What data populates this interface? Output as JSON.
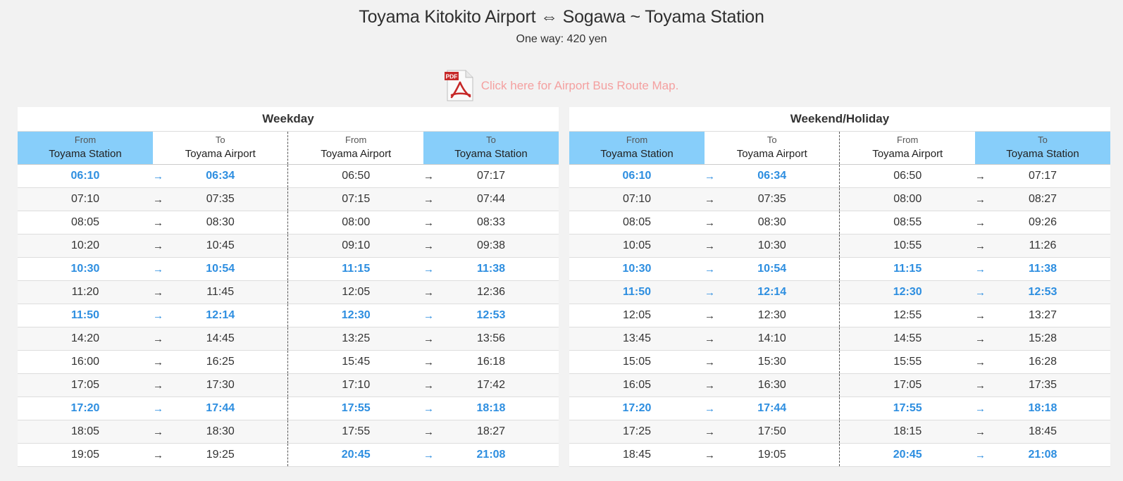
{
  "header": {
    "title": "Toyama Kitokito Airport ⇔ Sogawa ~ Toyama Station",
    "fare": "One way: 420 yen",
    "pdf_icon_label": "PDF",
    "map_link": "Click here for Airport Bus Route Map."
  },
  "colors": {
    "highlight": "#2d8ee0",
    "header_blue": "#87cefa",
    "link": "#f4a0a0"
  },
  "arrow": "→",
  "tables": [
    {
      "title": "Weekday",
      "columns": [
        {
          "small": "From",
          "big": "Toyama Station"
        },
        {
          "small": "To",
          "big": "Toyama Airport"
        },
        {
          "small": "From",
          "big": "Toyama Airport"
        },
        {
          "small": "To",
          "big": "Toyama Station"
        }
      ],
      "rows": [
        {
          "a": [
            "06:10",
            "06:34"
          ],
          "ah": true,
          "b": [
            "06:50",
            "07:17"
          ],
          "bh": false
        },
        {
          "a": [
            "07:10",
            "07:35"
          ],
          "ah": false,
          "b": [
            "07:15",
            "07:44"
          ],
          "bh": false
        },
        {
          "a": [
            "08:05",
            "08:30"
          ],
          "ah": false,
          "b": [
            "08:00",
            "08:33"
          ],
          "bh": false
        },
        {
          "a": [
            "10:20",
            "10:45"
          ],
          "ah": false,
          "b": [
            "09:10",
            "09:38"
          ],
          "bh": false
        },
        {
          "a": [
            "10:30",
            "10:54"
          ],
          "ah": true,
          "b": [
            "11:15",
            "11:38"
          ],
          "bh": true
        },
        {
          "a": [
            "11:20",
            "11:45"
          ],
          "ah": false,
          "b": [
            "12:05",
            "12:36"
          ],
          "bh": false
        },
        {
          "a": [
            "11:50",
            "12:14"
          ],
          "ah": true,
          "b": [
            "12:30",
            "12:53"
          ],
          "bh": true
        },
        {
          "a": [
            "14:20",
            "14:45"
          ],
          "ah": false,
          "b": [
            "13:25",
            "13:56"
          ],
          "bh": false
        },
        {
          "a": [
            "16:00",
            "16:25"
          ],
          "ah": false,
          "b": [
            "15:45",
            "16:18"
          ],
          "bh": false
        },
        {
          "a": [
            "17:05",
            "17:30"
          ],
          "ah": false,
          "b": [
            "17:10",
            "17:42"
          ],
          "bh": false
        },
        {
          "a": [
            "17:20",
            "17:44"
          ],
          "ah": true,
          "b": [
            "17:55",
            "18:18"
          ],
          "bh": true
        },
        {
          "a": [
            "18:05",
            "18:30"
          ],
          "ah": false,
          "b": [
            "17:55",
            "18:27"
          ],
          "bh": false
        },
        {
          "a": [
            "19:05",
            "19:25"
          ],
          "ah": false,
          "b": [
            "20:45",
            "21:08"
          ],
          "bh": true
        }
      ]
    },
    {
      "title": "Weekend/Holiday",
      "columns": [
        {
          "small": "From",
          "big": "Toyama Station"
        },
        {
          "small": "To",
          "big": "Toyama Airport"
        },
        {
          "small": "From",
          "big": "Toyama Airport"
        },
        {
          "small": "To",
          "big": "Toyama Station"
        }
      ],
      "rows": [
        {
          "a": [
            "06:10",
            "06:34"
          ],
          "ah": true,
          "b": [
            "06:50",
            "07:17"
          ],
          "bh": false
        },
        {
          "a": [
            "07:10",
            "07:35"
          ],
          "ah": false,
          "b": [
            "08:00",
            "08:27"
          ],
          "bh": false
        },
        {
          "a": [
            "08:05",
            "08:30"
          ],
          "ah": false,
          "b": [
            "08:55",
            "09:26"
          ],
          "bh": false
        },
        {
          "a": [
            "10:05",
            "10:30"
          ],
          "ah": false,
          "b": [
            "10:55",
            "11:26"
          ],
          "bh": false
        },
        {
          "a": [
            "10:30",
            "10:54"
          ],
          "ah": true,
          "b": [
            "11:15",
            "11:38"
          ],
          "bh": true
        },
        {
          "a": [
            "11:50",
            "12:14"
          ],
          "ah": true,
          "b": [
            "12:30",
            "12:53"
          ],
          "bh": true
        },
        {
          "a": [
            "12:05",
            "12:30"
          ],
          "ah": false,
          "b": [
            "12:55",
            "13:27"
          ],
          "bh": false
        },
        {
          "a": [
            "13:45",
            "14:10"
          ],
          "ah": false,
          "b": [
            "14:55",
            "15:28"
          ],
          "bh": false
        },
        {
          "a": [
            "15:05",
            "15:30"
          ],
          "ah": false,
          "b": [
            "15:55",
            "16:28"
          ],
          "bh": false
        },
        {
          "a": [
            "16:05",
            "16:30"
          ],
          "ah": false,
          "b": [
            "17:05",
            "17:35"
          ],
          "bh": false
        },
        {
          "a": [
            "17:20",
            "17:44"
          ],
          "ah": true,
          "b": [
            "17:55",
            "18:18"
          ],
          "bh": true
        },
        {
          "a": [
            "17:25",
            "17:50"
          ],
          "ah": false,
          "b": [
            "18:15",
            "18:45"
          ],
          "bh": false
        },
        {
          "a": [
            "18:45",
            "19:05"
          ],
          "ah": false,
          "b": [
            "20:45",
            "21:08"
          ],
          "bh": true
        }
      ]
    }
  ]
}
